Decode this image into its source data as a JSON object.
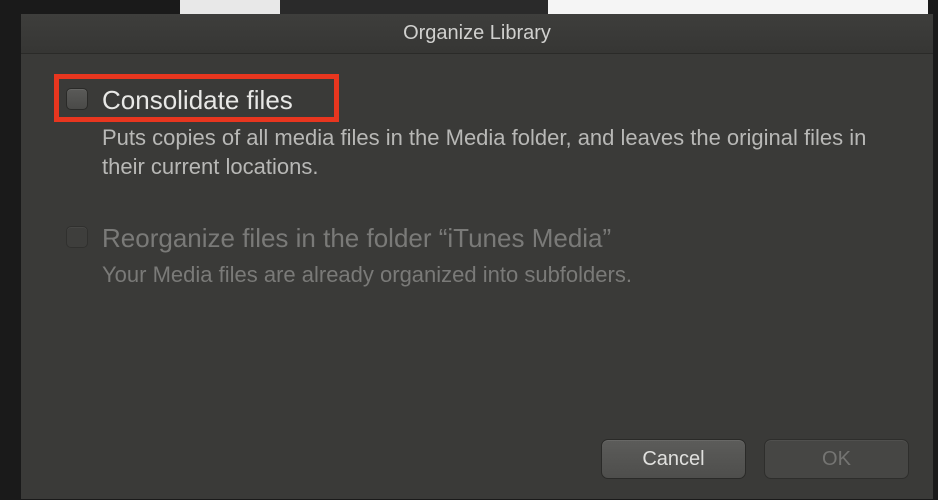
{
  "dialog": {
    "title": "Organize Library",
    "options": [
      {
        "label": "Consolidate files",
        "description": "Puts copies of all media files in the Media folder, and leaves the original files in their current locations.",
        "checked": false,
        "enabled": true,
        "highlighted": true
      },
      {
        "label": "Reorganize files in the folder “iTunes Media”",
        "description": "Your Media files are already organized into subfolders.",
        "checked": false,
        "enabled": false,
        "highlighted": false
      }
    ],
    "buttons": {
      "cancel": "Cancel",
      "ok": "OK"
    }
  }
}
